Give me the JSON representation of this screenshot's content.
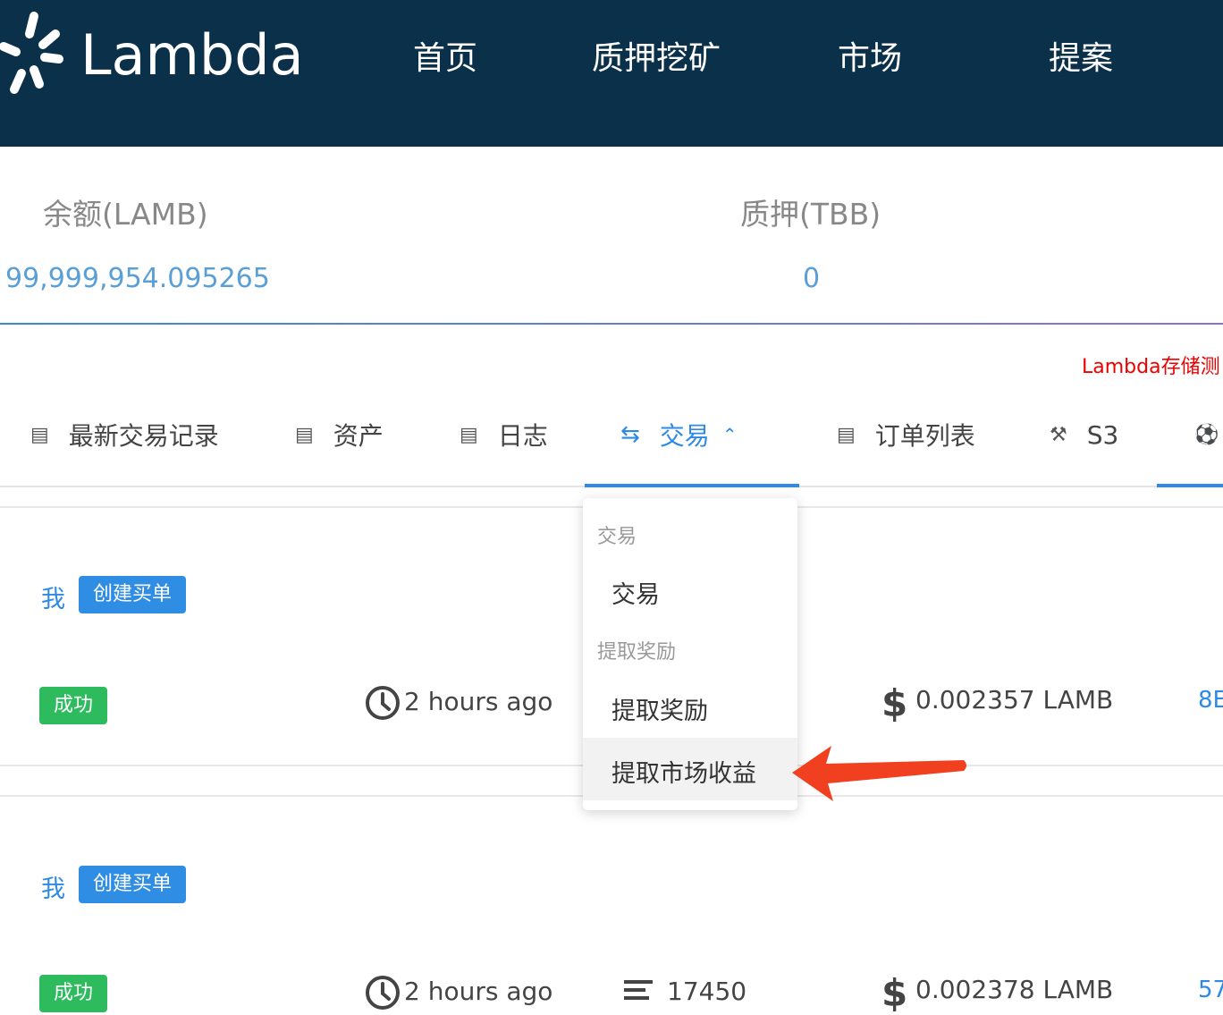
{
  "brand": {
    "name": "Lambda"
  },
  "nav": [
    "首页",
    "质押挖矿",
    "市场",
    "提案"
  ],
  "balances": [
    {
      "label": "余额(LAMB)",
      "value": "99,999,954.095265"
    },
    {
      "label": "质押(TBB)",
      "value": "0"
    }
  ],
  "notice": "Lambda存储测",
  "tabs": [
    {
      "label": "最新交易记录",
      "icon": "document-icon"
    },
    {
      "label": "资产",
      "icon": "document-icon"
    },
    {
      "label": "日志",
      "icon": "document-icon"
    },
    {
      "label": "交易",
      "icon": "swap-icon",
      "active": true
    },
    {
      "label": "订单列表",
      "icon": "document-icon"
    },
    {
      "label": "S3",
      "icon": "tools-icon"
    }
  ],
  "dropdown": {
    "groups": [
      {
        "title": "交易",
        "items": [
          "交易"
        ]
      },
      {
        "title": "提取奖励",
        "items": [
          "提取奖励",
          "提取市场收益"
        ]
      }
    ],
    "highlighted": "提取市场收益"
  },
  "transactions": [
    {
      "who": "我",
      "type": "创建买单",
      "status": "成功",
      "time": "2 hours ago",
      "amount": "0.002357 LAMB",
      "hash": "8E"
    },
    {
      "who": "我",
      "type": "创建买单",
      "status": "成功",
      "time": "2 hours ago",
      "height": "17450",
      "amount": "0.002378 LAMB",
      "hash": "57"
    }
  ],
  "colors": {
    "header": "#0b3049",
    "accent": "#2e8ae6",
    "success": "#2dbb5d",
    "arrow": "#f0401f"
  }
}
